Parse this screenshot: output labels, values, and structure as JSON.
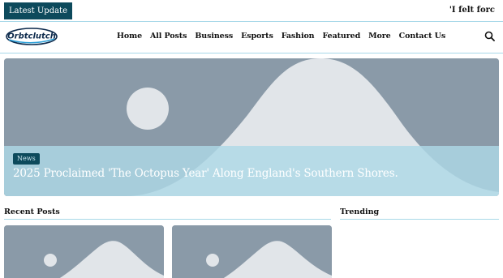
{
  "ticker": {
    "label": "Latest Update",
    "headline": "'I felt forc"
  },
  "header": {
    "logo_text": "Orbtclutch",
    "nav": [
      "Home",
      "All Posts",
      "Business",
      "Esports",
      "Fashion",
      "Featured",
      "More",
      "Contact Us"
    ]
  },
  "hero": {
    "tag": "News",
    "title": "2025 Proclaimed 'The Octopus Year' Along England's Southern Shores."
  },
  "sections": {
    "recent": "Recent Posts",
    "trending": "Trending"
  },
  "colors": {
    "accent": "#0d4a5c",
    "line": "#a8d8e8",
    "placeholder_bg": "#8a9aa8",
    "placeholder_fg": "#e1e5e9"
  }
}
